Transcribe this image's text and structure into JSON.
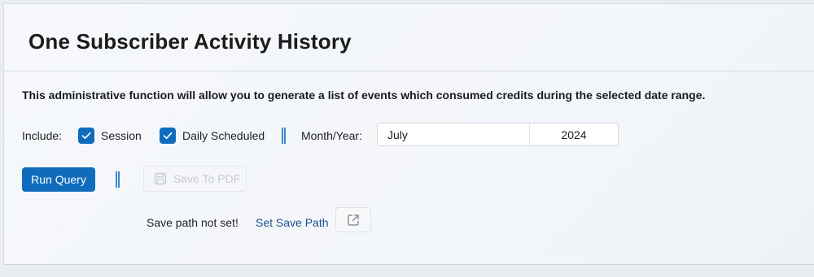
{
  "page": {
    "title": "One Subscriber Activity History",
    "description": "This administrative function will allow you to generate a list of events which consumed credits during the selected date range."
  },
  "filters": {
    "include_label": "Include:",
    "session": {
      "label": "Session",
      "checked": true
    },
    "daily_scheduled": {
      "label": "Daily Scheduled",
      "checked": true
    },
    "month_year_label": "Month/Year:",
    "month": "July",
    "year": "2024"
  },
  "actions": {
    "run_query_label": "Run Query",
    "save_pdf_label": "Save To PDF",
    "save_pdf_enabled": false
  },
  "save_path": {
    "status": "Save path not set!",
    "set_link": "Set Save Path"
  },
  "icons": {
    "checkbox": "check-icon",
    "save_pdf": "save-icon",
    "open_folder": "open-external-icon"
  },
  "colors": {
    "accent": "#0f6cbd",
    "link": "#1b4f8f",
    "separator": "#3a86d0"
  }
}
